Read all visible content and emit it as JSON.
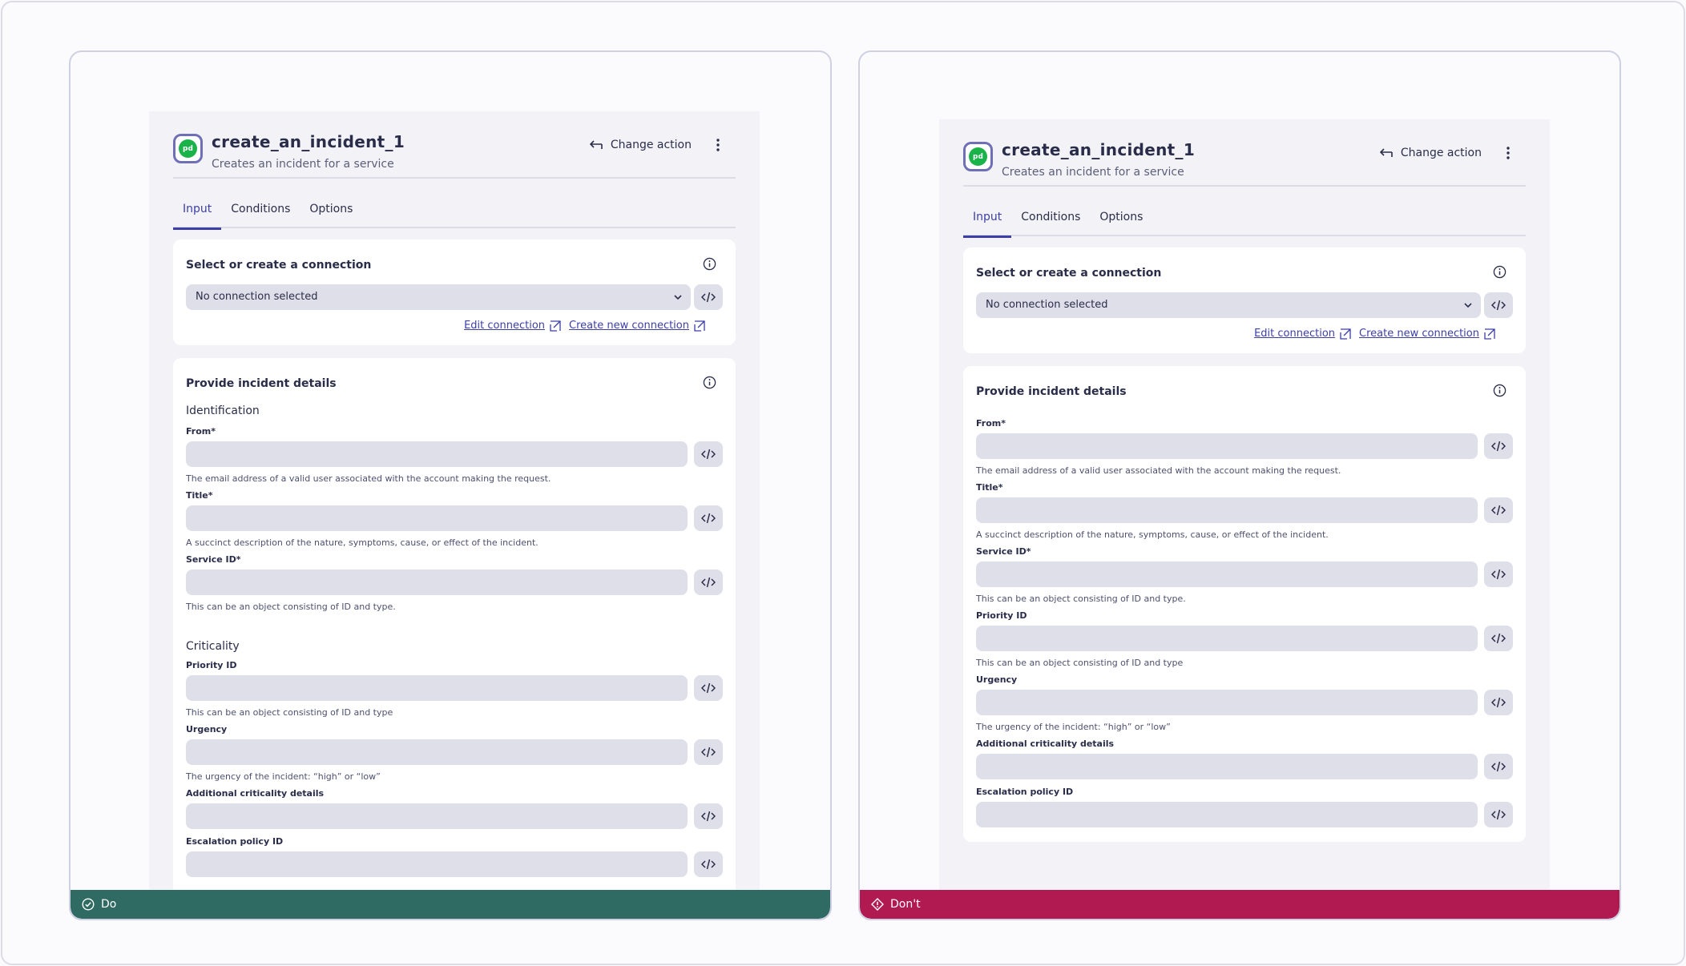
{
  "colors": {
    "do_banner": "#2f6b62",
    "dont_banner": "#b01a50",
    "accent": "#3b3fa6",
    "input_bg": "#dfdfe9",
    "logo_green": "#19b34a"
  },
  "examples": {
    "do": {
      "banner_label": "Do",
      "banner_icon": "check-circle-icon",
      "header": {
        "logo_text": "pd",
        "title": "create_an_incident_1",
        "subtitle": "Creates an incident for a service",
        "change_action": "Change action"
      },
      "tabs": [
        "Input",
        "Conditions",
        "Options"
      ],
      "connection": {
        "title": "Select or create a connection",
        "select_value": "No connection selected",
        "edit_link": "Edit connection",
        "create_link": "Create new connection"
      },
      "details": {
        "title": "Provide incident details",
        "group_identification": "Identification",
        "group_criticality": "Criticality",
        "fields": {
          "from": {
            "label": "From*",
            "help": "The email address of a valid user associated with the account making the request."
          },
          "title": {
            "label": "Title*",
            "help": "A succinct description of the nature, symptoms, cause, or effect of the incident."
          },
          "service_id": {
            "label": "Service ID*",
            "help": "This can be an object consisting of ID and type."
          },
          "priority_id": {
            "label": "Priority ID",
            "help": "This can be an object consisting of ID and type"
          },
          "urgency": {
            "label": "Urgency",
            "help": "The urgency of the incident: “high” or “low”"
          },
          "additional": {
            "label": "Additional criticality details"
          },
          "escalation": {
            "label": "Escalation policy ID"
          }
        }
      }
    },
    "dont": {
      "banner_label": "Don't",
      "banner_icon": "warning-diamond-icon",
      "header": {
        "logo_text": "pd",
        "title": "create_an_incident_1",
        "subtitle": "Creates an incident for a service",
        "change_action": "Change action"
      },
      "tabs": [
        "Input",
        "Conditions",
        "Options"
      ],
      "connection": {
        "title": "Select or create a connection",
        "select_value": "No connection selected",
        "edit_link": "Edit connection",
        "create_link": "Create new connection"
      },
      "details": {
        "title": "Provide incident details",
        "fields": {
          "from": {
            "label": "From*",
            "help": "The email address of a valid user associated with the account making the request."
          },
          "title": {
            "label": "Title*",
            "help": "A succinct description of the nature, symptoms, cause, or effect of the incident."
          },
          "service_id": {
            "label": "Service ID*",
            "help": "This can be an object consisting of ID and type."
          },
          "priority_id": {
            "label": "Priority ID",
            "help": "This can be an object consisting of ID and type"
          },
          "urgency": {
            "label": "Urgency",
            "help": "The urgency of the incident: “high” or “low”"
          },
          "additional": {
            "label": "Additional criticality details"
          },
          "escalation": {
            "label": "Escalation policy ID"
          }
        }
      }
    }
  }
}
